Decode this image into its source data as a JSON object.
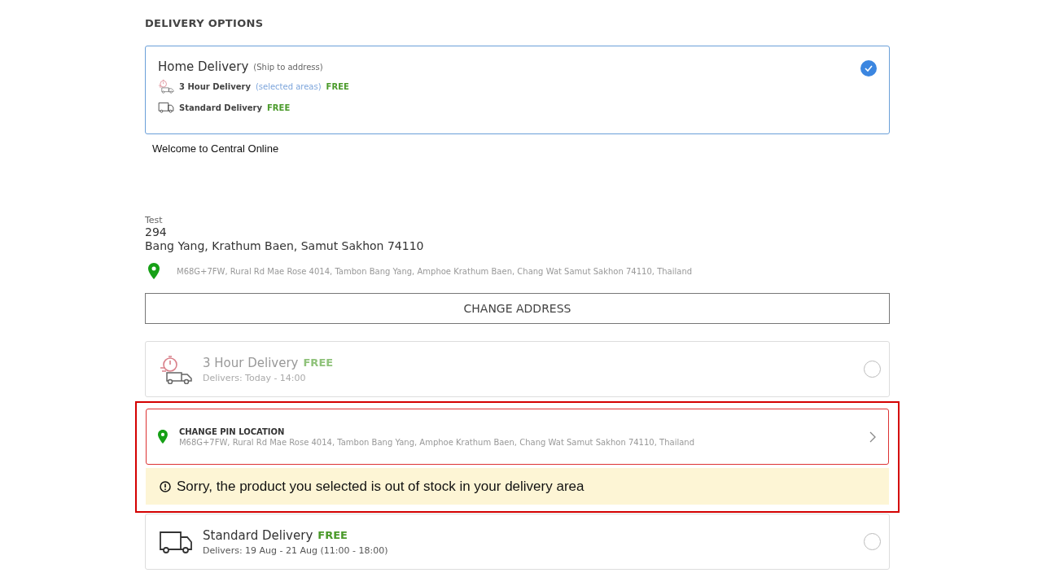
{
  "heading": "DELIVERY OPTIONS",
  "home_delivery": {
    "title": "Home Delivery",
    "subtitle": "(Ship to address)",
    "checked": true,
    "methods": [
      {
        "kind": "express",
        "label": "3 Hour Delivery",
        "note": "(selected areas)",
        "price": "FREE"
      },
      {
        "kind": "standard",
        "label": "Standard Delivery",
        "price": "FREE"
      }
    ]
  },
  "welcome": "Welcome to Central Online",
  "address": {
    "name": "Test",
    "line_1": "294",
    "line_2": "Bang Yang, Krathum Baen, Samut Sakhon 74110",
    "pin_address": "M68G+7FW, Rural Rd Mae Rose 4014, Tambon Bang Yang, Amphoe Krathum Baen, Chang Wat Samut Sakhon 74110, Thailand"
  },
  "change_address_button": "CHANGE ADDRESS",
  "express_option": {
    "kind": "express",
    "title": "3 Hour Delivery",
    "price": "FREE",
    "delivers": "Delivers: Today - 14:00",
    "selected": false,
    "disabled": true
  },
  "pin_location": {
    "title": "CHANGE PIN LOCATION",
    "address": "M68G+7FW, Rural Rd Mae Rose 4014, Tambon Bang Yang, Amphoe Krathum Baen, Chang Wat Samut Sakhon 74110, Thailand"
  },
  "warning": "Sorry, the product you selected is out of stock in your delivery area",
  "standard_option": {
    "kind": "standard",
    "title": "Standard Delivery",
    "price": "FREE",
    "delivers": "Delivers: 19 Aug - 21 Aug (11:00 - 18:00)",
    "selected": false,
    "disabled": false
  }
}
